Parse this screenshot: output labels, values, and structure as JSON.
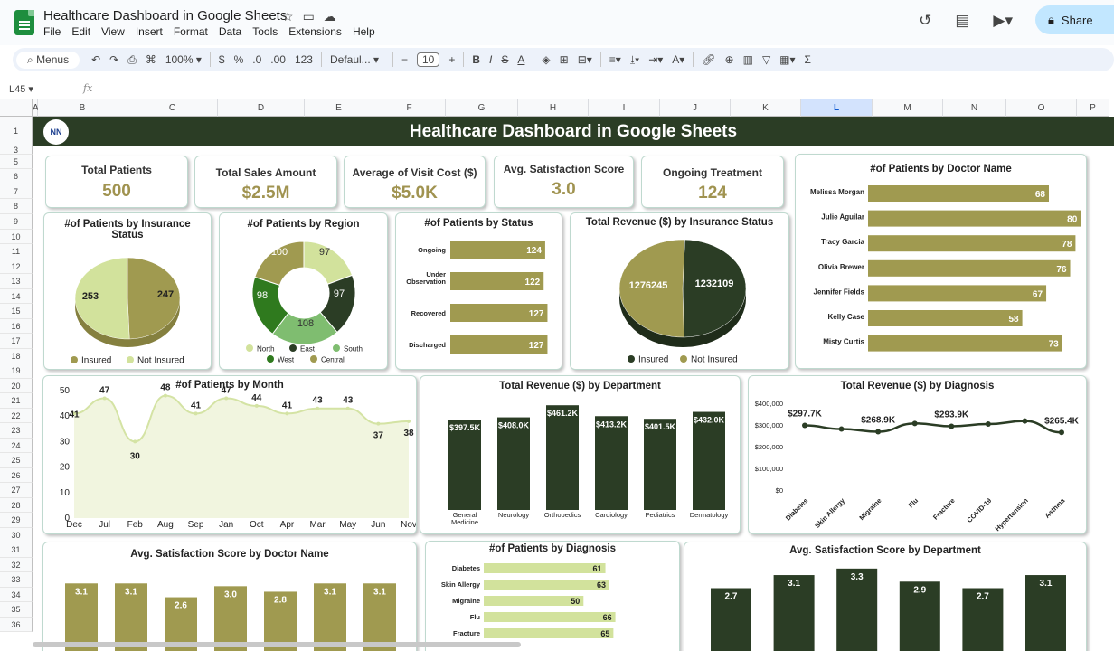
{
  "doc": {
    "title": "Healthcare Dashboard in Google Sheets"
  },
  "menu": [
    "File",
    "Edit",
    "View",
    "Insert",
    "Format",
    "Data",
    "Tools",
    "Extensions",
    "Help"
  ],
  "share_label": "Share",
  "toolbar": {
    "search": "Menus",
    "zoom": "100%",
    "currency": "$",
    "percent": "%",
    "dec_minus": ".0",
    "dec_plus": ".00",
    "format_123": "123",
    "font": "Defaul...",
    "font_size": "10"
  },
  "formula_bar": {
    "cell": "L45",
    "fx": "fx"
  },
  "columns": [
    "A",
    "B",
    "C",
    "D",
    "E",
    "F",
    "G",
    "H",
    "I",
    "J",
    "K",
    "L",
    "M",
    "N",
    "O",
    "P"
  ],
  "rows": [
    "1",
    "3",
    "5",
    "6",
    "7",
    "8",
    "9",
    "10",
    "11",
    "12",
    "13",
    "14",
    "15",
    "16",
    "17",
    "18",
    "19",
    "20",
    "21",
    "22",
    "23",
    "24",
    "25",
    "26",
    "27",
    "28",
    "29",
    "30",
    "31",
    "32",
    "33",
    "34",
    "35",
    "36"
  ],
  "dashboard": {
    "title": "Healthcare Dashboard in Google Sheets",
    "logo": "NN",
    "kpis": [
      {
        "label": "Total Patients",
        "value": "500"
      },
      {
        "label": "Total Sales Amount",
        "value": "$2.5M"
      },
      {
        "label": "Average of Visit Cost ($)",
        "value": "$5.0K"
      },
      {
        "label": "Avg. Satisfaction Score",
        "value": "3.0"
      },
      {
        "label": "Ongoing Treatment",
        "value": "124"
      }
    ]
  },
  "colors": {
    "olive": "#a09a50",
    "dark": "#2b3d25",
    "light": "#d2e29c",
    "mid": "#7fbd70",
    "area": "#f1f5df",
    "line": "#d4e3a4"
  },
  "chart_data": [
    {
      "id": "insurance",
      "type": "pie",
      "title": "#of Patients by Insurance Status",
      "labels": [
        "Insured",
        "Not Insured"
      ],
      "values": [
        247,
        253
      ],
      "legend": "bottom"
    },
    {
      "id": "region",
      "type": "pie",
      "title": "#of Patients by Region",
      "labels": [
        "North",
        "East",
        "South",
        "West",
        "Central"
      ],
      "values": [
        97,
        97,
        108,
        98,
        100
      ],
      "legend": "bottom"
    },
    {
      "id": "status",
      "type": "bar",
      "title": "#of Patients by Status",
      "categories": [
        "Ongoing",
        "Under Observation",
        "Recovered",
        "Discharged"
      ],
      "values": [
        124,
        122,
        127,
        127
      ]
    },
    {
      "id": "rev_insurance",
      "type": "pie",
      "title": "Total Revenue ($) by Insurance Status",
      "labels": [
        "Insured",
        "Not Insured"
      ],
      "values": [
        1232109,
        1276245
      ],
      "legend": "bottom"
    },
    {
      "id": "doctor",
      "type": "bar",
      "title": "#of Patients by Doctor Name",
      "categories": [
        "Melissa Morgan",
        "Julie Aguilar",
        "Tracy Garcia",
        "Olivia Brewer",
        "Jennifer Fields",
        "Kelly Case",
        "Misty Curtis"
      ],
      "values": [
        68,
        80,
        78,
        76,
        67,
        58,
        73
      ]
    },
    {
      "id": "month",
      "type": "area",
      "title": "#of Patients by Month",
      "categories": [
        "Dec",
        "Jan",
        "Feb",
        "Mar",
        "Apr",
        "May",
        "Jun",
        "Jul",
        "Aug",
        "Sep",
        "Oct",
        "Nov"
      ],
      "values": [
        41,
        47,
        30,
        48,
        41,
        47,
        44,
        41,
        43,
        43,
        37,
        38
      ],
      "x_ticks": [
        "Dec",
        "Jul",
        "Feb",
        "Aug",
        "Sep",
        "Jan",
        "Oct",
        "Apr",
        "Mar",
        "May",
        "Jun",
        "Nov"
      ],
      "y_ticks": [
        "0",
        "10",
        "20",
        "30",
        "40",
        "50"
      ],
      "ylim": [
        0,
        50
      ]
    },
    {
      "id": "rev_department",
      "type": "bar",
      "title": "Total Revenue ($) by Department",
      "categories": [
        "General Medicine",
        "Neurology",
        "Orthopedics",
        "Cardiology",
        "Pediatrics",
        "Dermatology"
      ],
      "values": [
        397.5,
        408,
        461.2,
        413.2,
        401.5,
        432
      ],
      "labels": [
        "$397.5K",
        "$408.0K",
        "$461.2K",
        "$413.2K",
        "$401.5K",
        "$432.0K"
      ]
    },
    {
      "id": "rev_diagnosis",
      "type": "line",
      "title": "Total Revenue ($) by Diagnosis",
      "categories": [
        "Diabetes",
        "Skin Allergy",
        "Migraine",
        "Flu",
        "Fracture",
        "COVID-19",
        "Hypertension",
        "Asthma"
      ],
      "values": [
        297.7,
        281,
        268.9,
        307,
        293.9,
        304,
        318,
        265.4
      ],
      "labels": [
        "$297.7K",
        "",
        "$268.9K",
        "",
        "$293.9K",
        "",
        "",
        "$265.4K"
      ],
      "y_ticks": [
        "$0",
        "$100,000",
        "$200,000",
        "$300,000",
        "$400,000"
      ],
      "ylim": [
        0,
        400
      ]
    },
    {
      "id": "sat_doctor",
      "type": "bar",
      "title": "Avg. Satisfaction Score by Doctor Name",
      "values": [
        3.1,
        3.1,
        2.6,
        3.0,
        2.8,
        3.1,
        3.1
      ],
      "labels": [
        "3.1",
        "3.1",
        "2.6",
        "3.0",
        "2.8",
        "3.1",
        "3.1"
      ]
    },
    {
      "id": "diagnosis",
      "type": "bar",
      "title": "#of Patients by Diagnosis",
      "categories": [
        "Diabetes",
        "Skin Allergy",
        "Migraine",
        "Flu",
        "Fracture"
      ],
      "values": [
        61,
        63,
        50,
        66,
        65
      ]
    },
    {
      "id": "sat_department",
      "type": "bar",
      "title": "Avg. Satisfaction Score by Department",
      "values": [
        2.7,
        3.1,
        3.3,
        2.9,
        2.7,
        3.1
      ],
      "labels": [
        "2.7",
        "3.1",
        "3.3",
        "2.9",
        "2.7",
        "3.1"
      ]
    }
  ]
}
